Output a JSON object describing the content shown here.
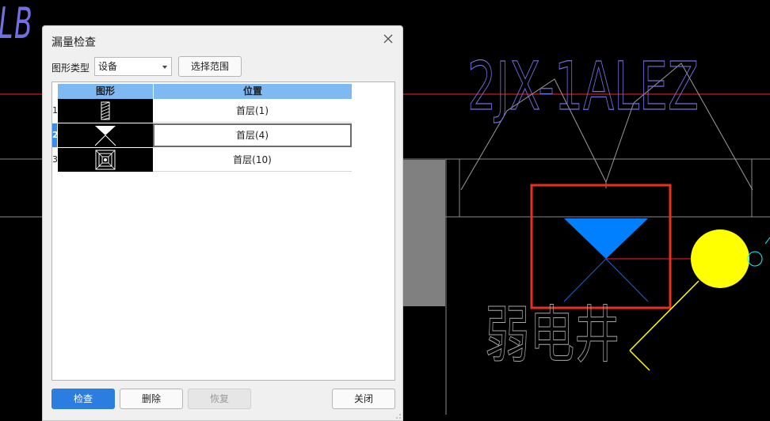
{
  "cad": {
    "label_top_left": "LB",
    "label_title": "2JX-1ALEZ",
    "label_room": "弱电井",
    "colors": {
      "background": "#000000",
      "text_blue": "#7070e0",
      "red_line": "#ff2020",
      "highlight_box": "#e83020",
      "symbol_fill": "#0080ff",
      "yellow": "#ffff00",
      "cyan": "#00ffff",
      "gray_block": "#808080"
    }
  },
  "dialog": {
    "title": "漏量检查",
    "close_icon": "close-icon",
    "type_label": "图形类型",
    "type_value": "设备",
    "select_range_label": "选择范围",
    "table": {
      "columns": [
        "图形",
        "位置"
      ],
      "rows": [
        {
          "index": "1",
          "shape_icon": "hatched-rectangle-symbol-icon",
          "position": "首层(1)",
          "selected": false
        },
        {
          "index": "2",
          "shape_icon": "hourglass-triangle-symbol-icon",
          "position": "首层(4)",
          "selected": true
        },
        {
          "index": "3",
          "shape_icon": "concentric-square-symbol-icon",
          "position": "首层(10)",
          "selected": false
        }
      ]
    },
    "buttons": {
      "check": "检查",
      "delete": "删除",
      "restore": "恢复",
      "close": "关闭"
    }
  }
}
